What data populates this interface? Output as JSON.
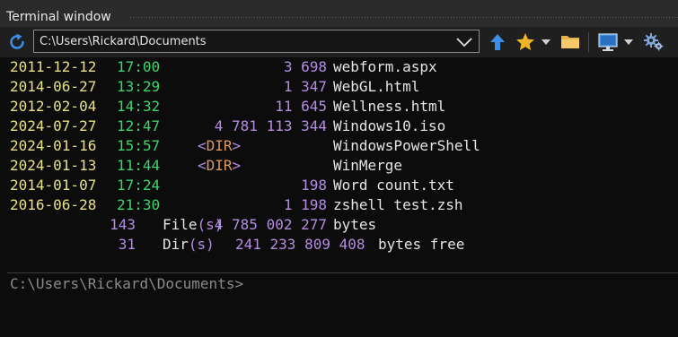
{
  "window": {
    "title": "Terminal window"
  },
  "toolbar": {
    "path": "C:\\Users\\Rickard\\Documents",
    "icons": [
      "refresh-icon",
      "chevron-down-icon",
      "up-arrow-icon",
      "star-icon",
      "folder-icon",
      "monitor-icon",
      "gear-icon"
    ],
    "colors": {
      "accent_blue": "#3b8fe6",
      "star": "#f0b429",
      "folder": "#e8b24a"
    }
  },
  "listing": {
    "entries": [
      {
        "date": "2011-12-12",
        "time": "17:00",
        "size": "3 698",
        "name": "webform.aspx"
      },
      {
        "date": "2014-06-27",
        "time": "13:29",
        "size": "1 347",
        "name": "WebGL.html"
      },
      {
        "date": "2012-02-04",
        "time": "14:32",
        "size": "11 645",
        "name": "Wellness.html"
      },
      {
        "date": "2024-07-27",
        "time": "12:47",
        "size": "4 781 113 344",
        "name": "Windows10.iso"
      },
      {
        "date": "2024-01-16",
        "time": "15:57",
        "dir_open": "<",
        "dir_word": "DIR",
        "dir_close": ">",
        "name": "WindowsPowerShell"
      },
      {
        "date": "2024-01-13",
        "time": "11:44",
        "dir_open": "<",
        "dir_word": "DIR",
        "dir_close": ">",
        "name": "WinMerge"
      },
      {
        "date": "2014-01-07",
        "time": "17:24",
        "size": "198",
        "name": "Word count.txt"
      },
      {
        "date": "2016-06-28",
        "time": "21:30",
        "size": "1 198",
        "name": "zshell test.zsh"
      }
    ],
    "summary": {
      "files_count": "143",
      "files_label_a": "File",
      "files_label_b": "(s)",
      "files_size": "4 785 002 277",
      "files_tail": "bytes",
      "dirs_count": "31",
      "dirs_label_a": "Dir",
      "dirs_label_b": "(s)",
      "dirs_free": "241 233 809 408",
      "dirs_tail": "bytes free"
    },
    "colors": {
      "date": "#e8e089",
      "time": "#3ed46c",
      "number": "#b68ce3",
      "dir": "#d99860",
      "text": "#e4e4e4"
    }
  },
  "input": {
    "prompt": "C:\\Users\\Rickard\\Documents>"
  }
}
